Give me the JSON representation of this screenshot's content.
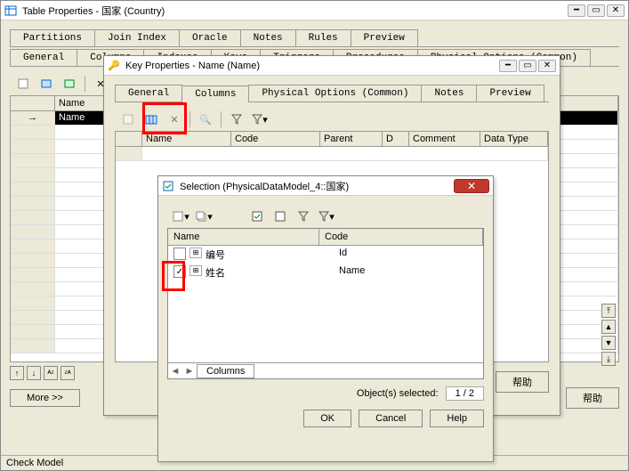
{
  "main": {
    "title": "Table Properties - 国家 (Country)",
    "tabs_row2": [
      "Partitions",
      "Join Index",
      "Oracle",
      "Notes",
      "Rules",
      "Preview"
    ],
    "tabs_row1": [
      "General",
      "Columns",
      "Indexes",
      "Keys",
      "Triggers",
      "Procedures",
      "Physical Options (Common)"
    ],
    "grid_headers": [
      "",
      "Name"
    ],
    "row0_name": "Name",
    "btn_more": "More >>",
    "btn_help": "帮助",
    "status": "Check Model"
  },
  "key": {
    "title": "Key Properties - Name (Name)",
    "tabs": [
      "General",
      "Columns",
      "Physical Options (Common)",
      "Notes",
      "Preview"
    ],
    "active_tab": 1,
    "grid_headers": [
      "",
      "Name",
      "Code",
      "Parent",
      "D",
      "Comment",
      "Data Type"
    ],
    "btn_help": "帮助"
  },
  "sel": {
    "title": "Selection (PhysicalDataModel_4::国家)",
    "head_name": "Name",
    "head_code": "Code",
    "rows": [
      {
        "checked": false,
        "name": "编号",
        "code": "Id"
      },
      {
        "checked": true,
        "name": "姓名",
        "code": "Name"
      }
    ],
    "tab_label": "Columns",
    "status_label": "Object(s) selected:",
    "status_count": "1 / 2",
    "btn_ok": "OK",
    "btn_cancel": "Cancel",
    "btn_help": "Help"
  }
}
